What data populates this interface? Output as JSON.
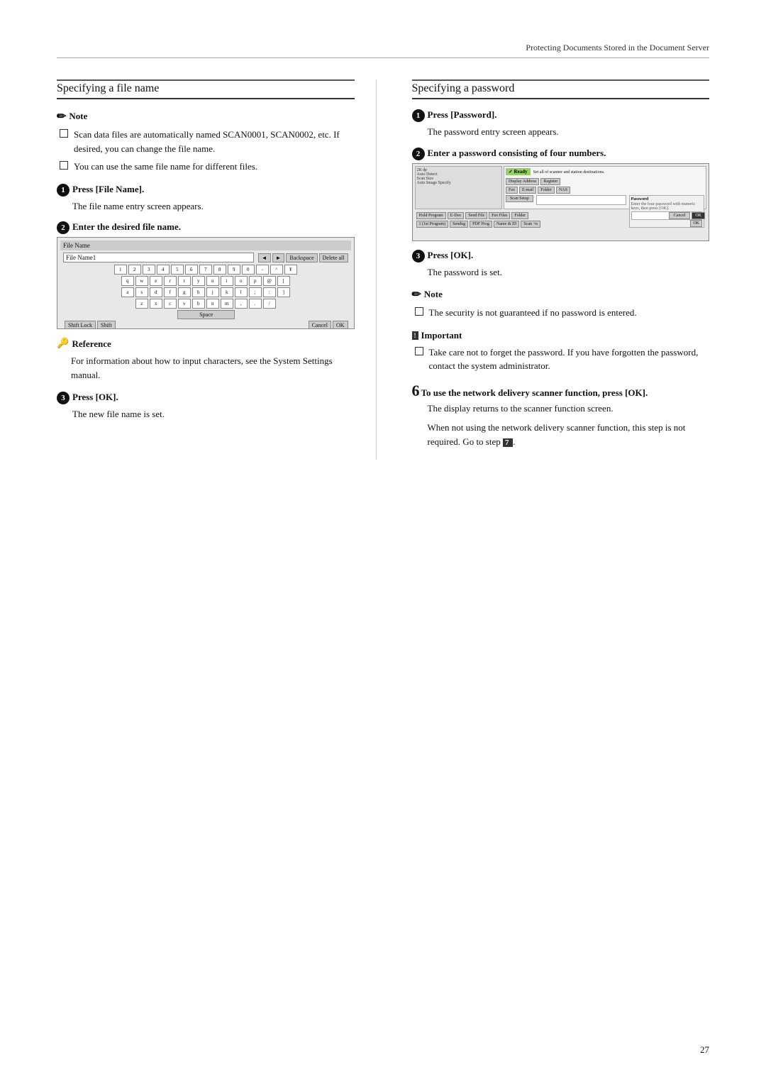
{
  "header": {
    "title": "Protecting Documents Stored in the Document Server"
  },
  "left": {
    "section_title": "Specifying a file name",
    "note_label": "Note",
    "note_items": [
      "Scan data files are automatically named SCAN0001, SCAN0002, etc. If desired, you can change the file name.",
      "You can use the same file name for different files."
    ],
    "step1_label": "Press [File Name].",
    "step1_desc": "The file name entry screen appears.",
    "step2_label": "Enter the desired file name.",
    "reference_label": "Reference",
    "reference_text": "For information about how to input characters, see the System Settings manual.",
    "step3_label": "Press [OK].",
    "step3_desc": "The new file name is set."
  },
  "right": {
    "section_title": "Specifying a password",
    "step1_label": "Press [Password].",
    "step1_desc": "The password entry screen appears.",
    "step2_label": "Enter a password consisting of four numbers.",
    "step3_label": "Press [OK].",
    "step3_desc": "The password is set.",
    "note_label": "Note",
    "note_items": [
      "The security is not guaranteed if no password is entered."
    ],
    "important_label": "Important",
    "important_items": [
      "Take care not to forget the password. If you have forgotten the password, contact the system administrator."
    ],
    "step6_label": "To use the network delivery scanner function, press [OK].",
    "step6_desc1": "The display returns to the scanner function screen.",
    "step6_desc2": "When not using the network delivery scanner function, this step is not required. Go to step",
    "step6_step_ref": "7",
    "step6_period": "."
  },
  "page_number": "27",
  "keyboard": {
    "label": "File Name",
    "input_placeholder": "File Name1",
    "keys_row1": [
      "1",
      "2",
      "3",
      "4",
      "5",
      "6",
      "7",
      "8",
      "9",
      "0",
      "-",
      "^",
      "¥"
    ],
    "keys_row2": [
      "q",
      "w",
      "e",
      "r",
      "t",
      "y",
      "u",
      "i",
      "o",
      "p",
      "@",
      "["
    ],
    "keys_row3": [
      "a",
      "s",
      "d",
      "f",
      "g",
      "h",
      "j",
      "k",
      "l",
      ";",
      ":",
      "]"
    ],
    "keys_row4": [
      "z",
      "x",
      "c",
      "v",
      "b",
      "n",
      "m",
      ",",
      ".",
      "/"
    ],
    "btn_backspace": "Backspace",
    "btn_delete_all": "Delete all",
    "btn_space": "Space",
    "btn_shift": "Shift Lock",
    "btn_shift2": "Shift",
    "btn_cancel": "Cancel",
    "btn_ok": "OK"
  }
}
